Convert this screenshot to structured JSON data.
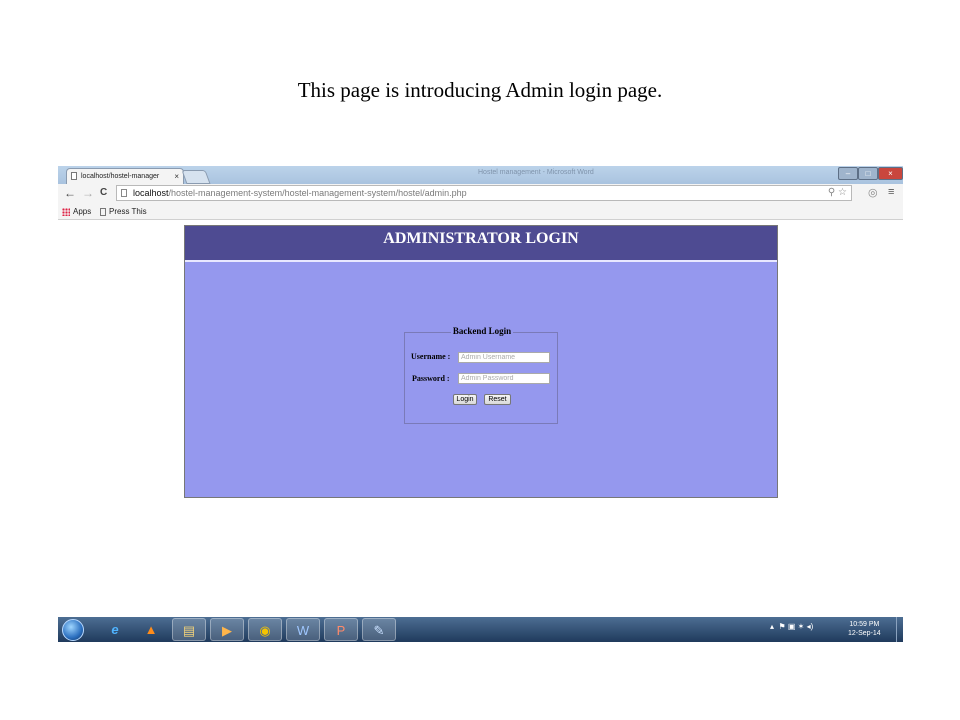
{
  "slide": {
    "caption": "This page is introducing Admin login page."
  },
  "browser": {
    "tab_title": "localhost/hostel-manager",
    "tab_close": "×",
    "window_title": "Hostel management - Microsoft Word",
    "controls": {
      "minimize": "–",
      "maximize": "□",
      "close": "×"
    },
    "nav": {
      "back": "←",
      "forward": "→",
      "reload": "C"
    },
    "url_host": "localhost",
    "url_path": "/hostel-management-system/hostel-management-system/hostel/admin.php",
    "bookmarks": [
      "Apps",
      "Press This"
    ]
  },
  "admin_page": {
    "header_title": "ADMINISTRATOR LOGIN",
    "form": {
      "legend": "Backend Login",
      "username_label": "Username :",
      "username_placeholder": "Admin Username",
      "password_label": "Password :",
      "password_placeholder": "Admin Password",
      "login_button": "Login",
      "reset_button": "Reset"
    },
    "colors": {
      "header_bg": "#4e4b92",
      "body_bg": "#9598ee"
    }
  },
  "taskbar": {
    "apps": [
      "internet-explorer-icon",
      "vlc-icon",
      "file-explorer-icon",
      "media-player-icon",
      "chrome-icon",
      "word-icon",
      "powerpoint-icon",
      "paint-icon"
    ],
    "clock_time": "10:59 PM",
    "clock_date": "12-Sep-14"
  }
}
